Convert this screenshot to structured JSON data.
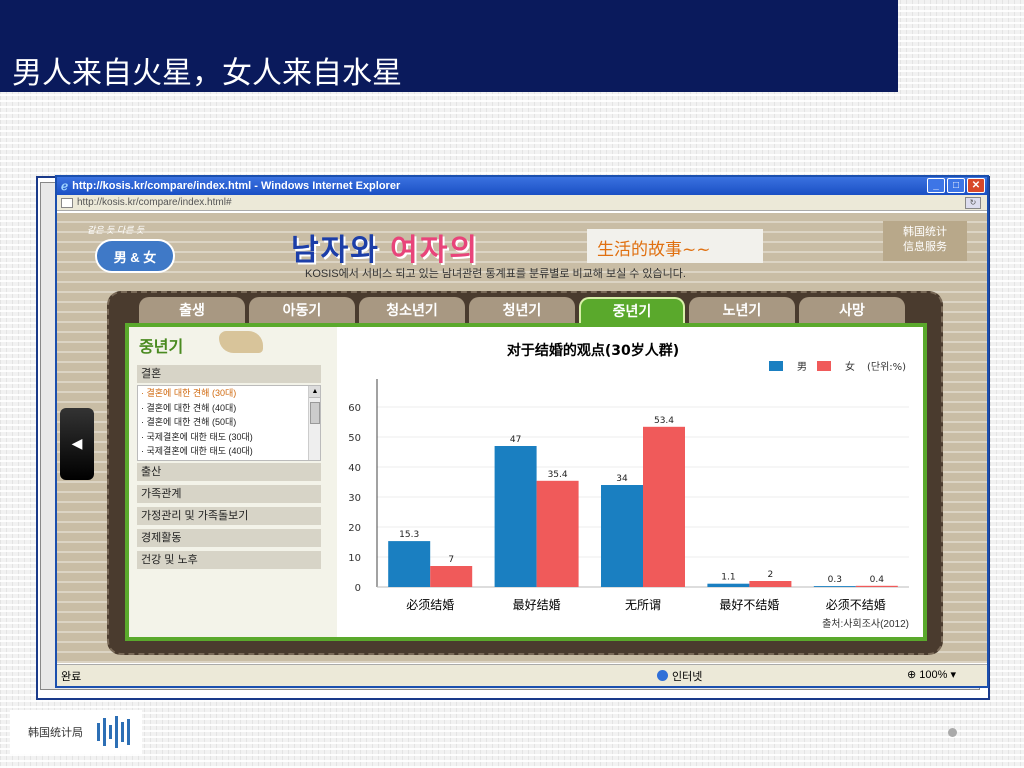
{
  "slide": {
    "title": "男人来自火星，女人来自水星",
    "footer_org": "韩国统计局"
  },
  "browser": {
    "window_title": "http://kosis.kr/compare/index.html - Windows Internet Explorer",
    "address": "http://kosis.kr/compare/index.html#",
    "status_done": "완료",
    "status_zone": "인터넷",
    "status_zoom": "100%"
  },
  "site": {
    "logo_tagline": "같은 듯 다른 듯",
    "logo_label": "男 & 女",
    "heading_blue": "남자와",
    "heading_pink": "여자의",
    "story_text": "生活的故事~~",
    "subtitle": "KOSIS에서 서비스 되고 있는 남녀관련 통계표를 분류별로 비교해 보실 수 있습니다.",
    "info_box_line1": "韩国统计",
    "info_box_line2": "信息服务"
  },
  "tabs": [
    {
      "label": "출생"
    },
    {
      "label": "아동기"
    },
    {
      "label": "청소년기"
    },
    {
      "label": "청년기"
    },
    {
      "label": "중년기",
      "active": true
    },
    {
      "label": "노년기"
    },
    {
      "label": "사망"
    }
  ],
  "sidebar": {
    "heading": "중년기",
    "categories": [
      "결혼",
      "출산",
      "가족관계",
      "가정관리 및 가족돌보기",
      "경제활동",
      "건강 및 노후"
    ],
    "marriage_items": [
      "· 결혼에 대한 견해 (30대)",
      "· 결혼에 대한 견해 (40대)",
      "· 결혼에 대한 견해 (50대)",
      "· 국제결혼에 대한 태도 (30대)",
      "· 국제결혼에 대한 태도 (40대)"
    ]
  },
  "chart_data": {
    "type": "bar",
    "title": "对于结婚的观点(30岁人群)",
    "categories": [
      "必须结婚",
      "最好结婚",
      "无所谓",
      "最好不结婚",
      "必须不结婚"
    ],
    "series": [
      {
        "name": "男",
        "color": "#1a7fc1",
        "values": [
          15.3,
          47,
          34,
          1.1,
          0.3
        ]
      },
      {
        "name": "女",
        "color": "#f05a5a",
        "values": [
          7,
          35.4,
          53.4,
          2,
          0.4
        ]
      }
    ],
    "unit_label": "(단위:%)",
    "yticks": [
      0,
      10,
      20,
      30,
      40,
      50,
      60
    ],
    "ylim": [
      0,
      68
    ],
    "grid": true,
    "legend_position": "top-right",
    "source": "출처:사회조사(2012)"
  }
}
